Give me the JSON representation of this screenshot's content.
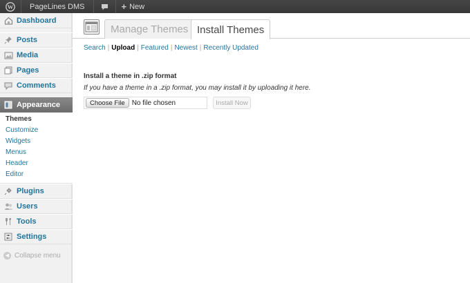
{
  "adminbar": {
    "site_name": "PageLines DMS",
    "new_label": "New"
  },
  "sidebar": {
    "items": [
      {
        "label": "Dashboard",
        "icon": "dashboard-icon"
      },
      {
        "label": "Posts",
        "icon": "pin-icon"
      },
      {
        "label": "Media",
        "icon": "media-icon"
      },
      {
        "label": "Pages",
        "icon": "pages-icon"
      },
      {
        "label": "Comments",
        "icon": "comment-icon"
      },
      {
        "label": "Appearance",
        "icon": "appearance-icon"
      },
      {
        "label": "Plugins",
        "icon": "plug-icon"
      },
      {
        "label": "Users",
        "icon": "users-icon"
      },
      {
        "label": "Tools",
        "icon": "tools-icon"
      },
      {
        "label": "Settings",
        "icon": "settings-icon"
      }
    ],
    "appearance_submenu": [
      "Themes",
      "Customize",
      "Widgets",
      "Menus",
      "Header",
      "Editor"
    ],
    "collapse_label": "Collapse menu"
  },
  "tabs": {
    "manage": "Manage Themes",
    "install": "Install Themes"
  },
  "subnav": {
    "search": "Search",
    "upload": "Upload",
    "featured": "Featured",
    "newest": "Newest",
    "recently_updated": "Recently Updated",
    "separator": "|"
  },
  "upload": {
    "heading": "Install a theme in .zip format",
    "description": "If you have a theme in a .zip format, you may install it by uploading it here.",
    "choose_file": "Choose File",
    "no_file": "No file chosen",
    "install_now": "Install Now"
  },
  "colors": {
    "link": "#21759b",
    "adminbar": "#464646",
    "active_menu": "#777777"
  }
}
